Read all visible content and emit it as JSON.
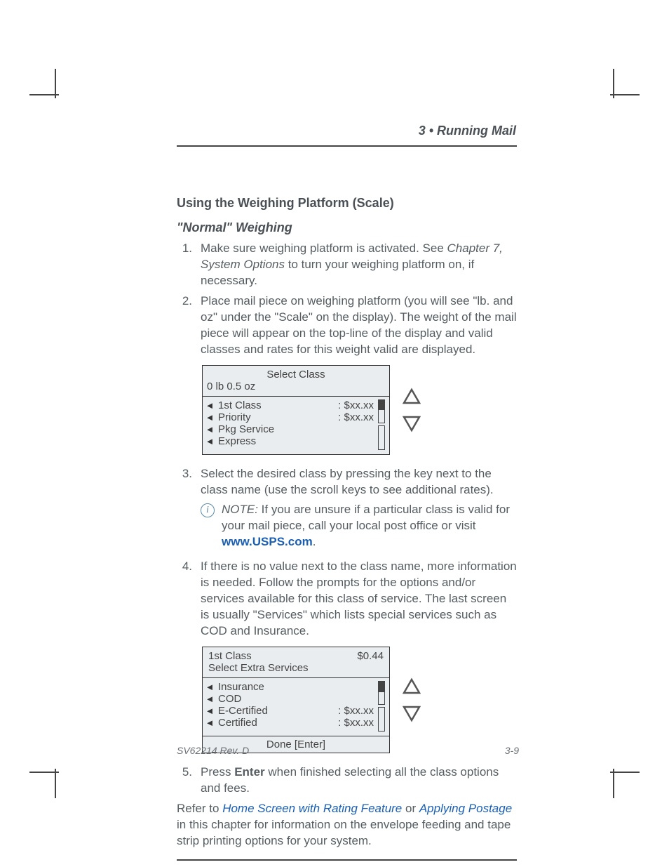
{
  "chapter_label": "3 • Running Mail",
  "section_title": "Using the Weighing Platform (Scale)",
  "sub_heading": "\"Normal\" Weighing",
  "steps": {
    "s1": {
      "num": "1.",
      "lead": "Make sure weighing platform is activated. See ",
      "link_text": "Chapter 7, System Options",
      "tail": " to turn your weighing platform on, if necessary."
    },
    "s2": {
      "num": "2.",
      "text": "Place mail piece on weighing platform (you will see \"lb. and oz\" under the \"Scale\" on the display). The weight of the mail piece will appear on the top-line of the display and valid classes and rates for this weight valid are displayed."
    },
    "s3": {
      "num": "3.",
      "text": "Select the desired class by pressing the key next to the class name (use the scroll keys to see additional rates)."
    },
    "s4": {
      "num": "4.",
      "text": "If there is no value next to the class name, more information is needed. Follow the prompts for the options and/or services available for this class of service. The last screen is usually \"Services\" which lists special services such as COD and Insurance."
    },
    "s5": {
      "num": "5.",
      "lead": "Press ",
      "key": "Enter",
      "tail": " when finished selecting all the class options and fees."
    }
  },
  "note": {
    "label": "NOTE:",
    "text_a": " If you are unsure if a particular class is valid for your mail piece, call your local post office or visit ",
    "link": "www.USPS.com",
    "text_b": "."
  },
  "display1": {
    "title": "Select Class",
    "weight": "0 lb 0.5 oz",
    "rows": [
      {
        "label": "1st Class",
        "value": ":  $xx.xx"
      },
      {
        "label": "Priority",
        "value": ":  $xx.xx"
      },
      {
        "label": "Pkg Service",
        "value": ""
      },
      {
        "label": "Express",
        "value": ""
      }
    ]
  },
  "display2": {
    "class_label": "1st Class",
    "price": "$0.44",
    "sub": "Select Extra Services",
    "rows": [
      {
        "label": "Insurance",
        "value": ""
      },
      {
        "label": "COD",
        "value": ""
      },
      {
        "label": "E-Certified",
        "value": ":  $xx.xx"
      },
      {
        "label": "Certified",
        "value": ":  $xx.xx"
      }
    ],
    "footer": "Done [Enter]"
  },
  "closing": {
    "a": "Refer to ",
    "link1": "Home Screen with Rating Feature ",
    "b": "or ",
    "link2": "Applying Postage",
    "c": " in this chapter for information on the envelope feeding and tape strip printing options for your system."
  },
  "doc_code": "SV62214 Rev. D",
  "page_num": "3-9"
}
